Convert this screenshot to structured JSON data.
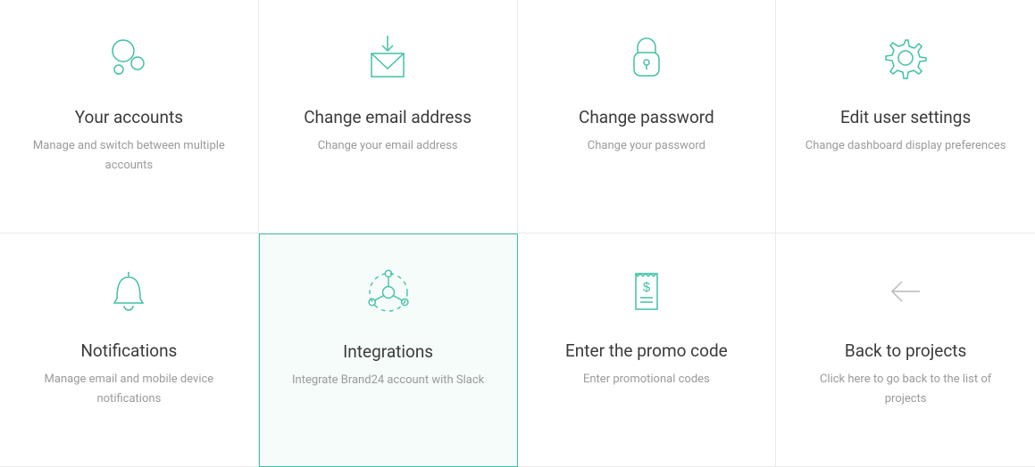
{
  "colors": {
    "accent": "#41c1a7",
    "grey": "#b9b9b9"
  },
  "cards": [
    {
      "title": "Your accounts",
      "desc": "Manage and switch between multiple accounts"
    },
    {
      "title": "Change email address",
      "desc": "Change your email address"
    },
    {
      "title": "Change password",
      "desc": "Change your password"
    },
    {
      "title": "Edit user settings",
      "desc": "Change dashboard display preferences"
    },
    {
      "title": "Notifications",
      "desc": "Manage email and mobile device notifications"
    },
    {
      "title": "Integrations",
      "desc": "Integrate Brand24 account with Slack"
    },
    {
      "title": "Enter the promo code",
      "desc": "Enter promotional codes"
    },
    {
      "title": "Back to projects",
      "desc": "Click here to go back to the list of projects"
    }
  ]
}
